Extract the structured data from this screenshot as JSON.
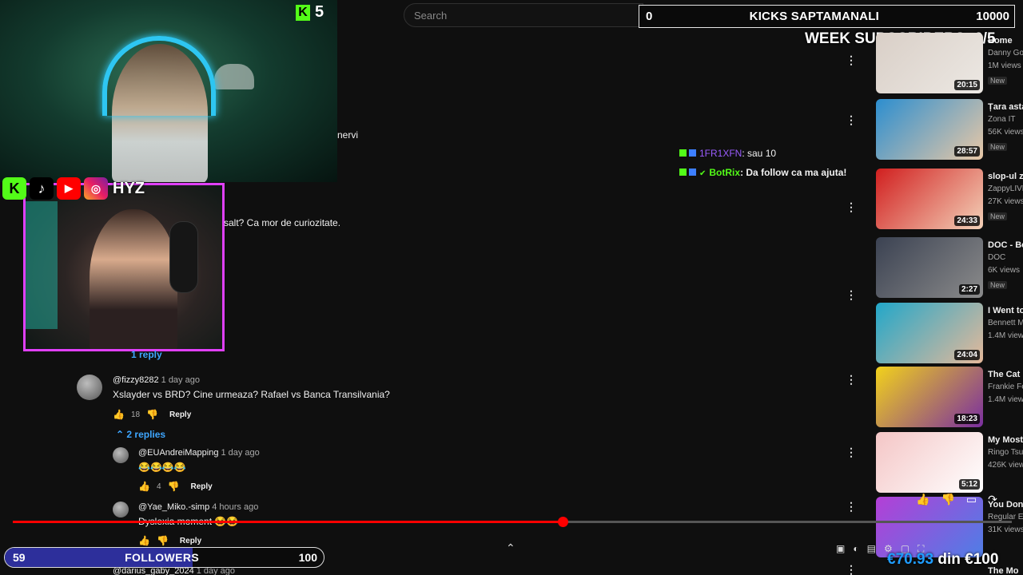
{
  "search": {
    "placeholder": "Search"
  },
  "kicks_goal": {
    "current": "0",
    "title": "KICKS SAPTAMANALI",
    "target": "10000"
  },
  "week_subscribers": "WEEK SUBSCRIBERS: 0/5",
  "kick_badge": {
    "count": "5"
  },
  "socials": {
    "handle": "HYZ"
  },
  "comment_fragments": {
    "nervi": "nervi",
    "curious": "salt? Ca mor de curiozitate.",
    "one_reply": "1 reply"
  },
  "comments": [
    {
      "author": "@fizzy8282",
      "time": "1 day ago",
      "text": "Xslayder vs BRD? Cine urmeaza? Rafael vs Banca Transilvania?",
      "likes": "18",
      "reply": "Reply"
    },
    {
      "author": "@EUAndreiMapping",
      "time": "1 day ago",
      "text": "😂😂😂😂",
      "likes": "4",
      "reply": "Reply"
    },
    {
      "author": "@Yae_Miko.-simp",
      "time": "4 hours ago",
      "text": "Dyslexia moment 😂😂",
      "likes": "",
      "reply": "Reply"
    },
    {
      "author": "@darius_gaby_2024",
      "time": "1 day ago"
    }
  ],
  "replies_toggle": "2 replies",
  "chat": [
    {
      "user": "1FR1XFN",
      "message": ": sau 10"
    },
    {
      "user": "BotRix",
      "message": ": Da follow ca ma ajuta!"
    }
  ],
  "videos": [
    {
      "title": "Home",
      "channel": "Danny Gon",
      "views": "1M views",
      "badge": "New",
      "duration": "20:15",
      "colors": [
        "#d9cfc7",
        "#ece8e3"
      ]
    },
    {
      "title": "Țara asta [RANT]",
      "channel": "Zona IT",
      "views": "56K views",
      "badge": "New",
      "duration": "28:57",
      "colors": [
        "#2c8ecf",
        "#e9c8a6"
      ]
    },
    {
      "title": "slop-ul zi \"influenc",
      "channel": "ZappyLIVE",
      "views": "27K views",
      "badge": "New",
      "duration": "24:33",
      "colors": [
        "#d11f1f",
        "#f3d1b8"
      ]
    },
    {
      "title": "DOC - Bo",
      "channel": "DOC",
      "views": "6K views",
      "badge": "New",
      "duration": "2:27",
      "colors": [
        "#3b4252",
        "#8b8b8b"
      ]
    },
    {
      "title": "I Went to Arabia...",
      "channel": "Bennett M",
      "views": "1.4M views",
      "badge": "",
      "duration": "24:04",
      "colors": [
        "#22a7c9",
        "#e5b99a"
      ]
    },
    {
      "title": "The Cat Internet:",
      "channel": "Frankie Fe",
      "views": "1.4M views",
      "badge": "",
      "duration": "18:23",
      "colors": [
        "#f2d21b",
        "#7a2ea0"
      ]
    },
    {
      "title": "My Most Japanese",
      "channel": "Ringo Tsu",
      "views": "426K views",
      "badge": "",
      "duration": "5:12",
      "colors": [
        "#f4c6c6",
        "#ffffff"
      ]
    },
    {
      "title": "You Don' Things",
      "channel": "Regular Ey",
      "views": "31K views",
      "badge": "",
      "duration": "",
      "colors": [
        "#b43fd6",
        "#4e7ee6"
      ]
    }
  ],
  "last_video_title": "The Mo",
  "progress": {
    "fraction": 0.55
  },
  "followers": {
    "current": 59,
    "label": "FOLLOWERS",
    "goal": 100
  },
  "donation": {
    "current": "€70.93",
    "goal": " din €100"
  }
}
